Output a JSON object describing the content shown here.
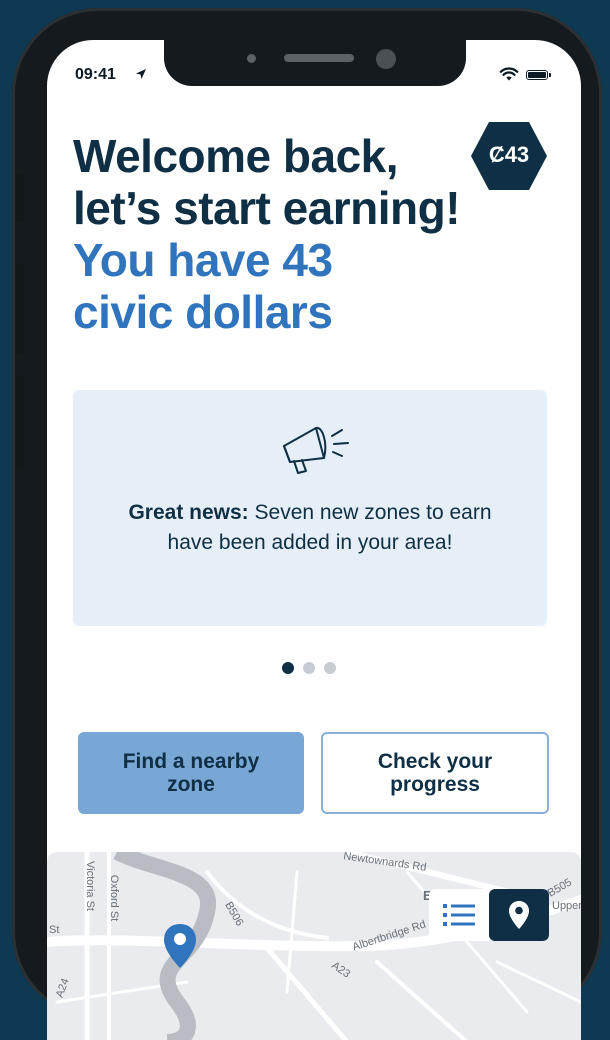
{
  "status_bar": {
    "time": "09:41"
  },
  "header": {
    "line1": "Welcome back,",
    "line2": "let’s start earning!",
    "balance_line1": "You have 43",
    "balance_line2": "civic dollars"
  },
  "badge": {
    "label": "Ȼ43"
  },
  "news_card": {
    "bold": "Great news:",
    "text": " Seven new zones to earn have been added in your area!"
  },
  "pagination": {
    "active_index": 0,
    "count": 3
  },
  "actions": {
    "find_label": "Find a nearby zone",
    "check_label": "Check your progress"
  },
  "map": {
    "labels": [
      "Newtownards Rd",
      "Victoria St",
      "Oxford St",
      "B506",
      "Albertbridge Rd",
      "A23",
      "B505",
      "Upper",
      "St",
      "A24",
      "E"
    ]
  },
  "colors": {
    "navy": "#0e2f44",
    "blue": "#2f74bd",
    "card_bg": "#e6eef7",
    "primary_button": "#78a7d6",
    "background": "#0d3a52"
  },
  "icons": [
    "location-arrow-icon",
    "wifi-icon",
    "battery-icon",
    "megaphone-icon",
    "list-icon",
    "map-pin-icon"
  ]
}
